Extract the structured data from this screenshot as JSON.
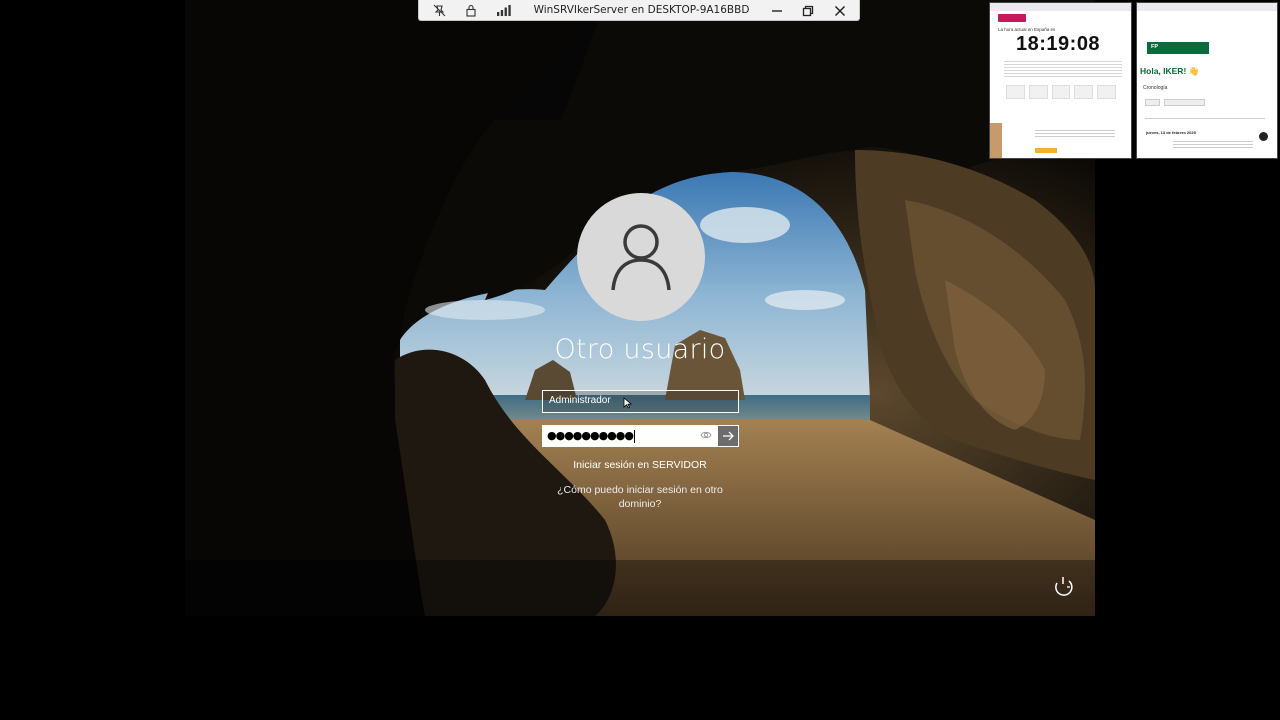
{
  "rdp_bar": {
    "title": "WinSRVIkerServer en DESKTOP-9A16BBD",
    "icons": [
      "pin-off-icon",
      "lock-icon",
      "signal-bars-icon",
      "minimize-icon",
      "restore-icon",
      "close-icon"
    ]
  },
  "login": {
    "user_display_name": "Otro usuario",
    "username_value": "Administrador",
    "password_masked": "●●●●●●●●●●",
    "signin_target": "Iniciar sesión en SERVIDOR",
    "other_domain_link": "¿Cómo puedo iniciar sesión en otro dominio?"
  },
  "thumbnails": {
    "left": {
      "clock_text": "18:19:08",
      "header_button": "",
      "heading_fragment": "La hora actual en España es"
    },
    "right": {
      "greeting": "Hola, IKER! 👋",
      "section": "Cronología",
      "badge": "FP",
      "date_heading": "jueves, 13 de febrero 2025"
    }
  },
  "colors": {
    "login_field_border": "#ffffff",
    "submit_bg": "#6c6c6c",
    "avatar_bg": "#d9d9d9",
    "fp_green": "#0b6b3a"
  }
}
